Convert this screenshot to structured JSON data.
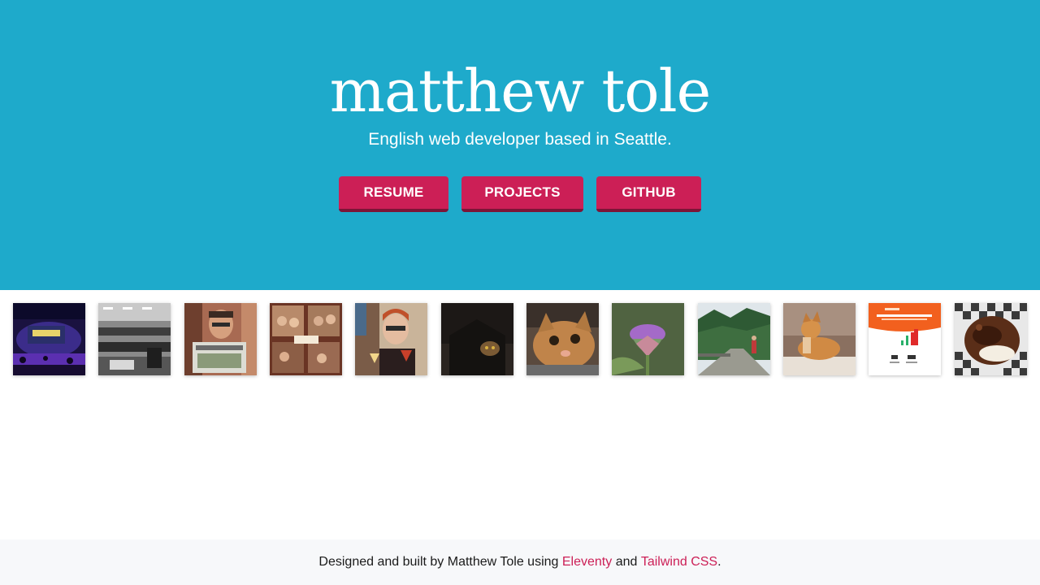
{
  "hero": {
    "title": "matthew tole",
    "subtitle": "English web developer based in Seattle.",
    "buttons": [
      {
        "label": "RESUME"
      },
      {
        "label": "PROJECTS"
      },
      {
        "label": "GITHUB"
      }
    ],
    "background_color": "#1eaacb",
    "button_color": "#cc1f56"
  },
  "gallery": {
    "items": [
      {
        "subject": "concert-stage-photo"
      },
      {
        "subject": "black-and-white-office-photo"
      },
      {
        "subject": "man-holding-book-photo"
      },
      {
        "subject": "photo-booth-strip"
      },
      {
        "subject": "woman-with-drink-photo"
      },
      {
        "subject": "cat-in-dark-photo"
      },
      {
        "subject": "cat-closeup-photo"
      },
      {
        "subject": "artichoke-flower-photo"
      },
      {
        "subject": "forest-trestle-photo"
      },
      {
        "subject": "cat-sitting-photo"
      },
      {
        "subject": "infographic-screenshot"
      },
      {
        "subject": "dessert-photo"
      }
    ]
  },
  "footer": {
    "text_before": "Designed and built by Matthew Tole using ",
    "link1": "Eleventy",
    "text_middle": " and ",
    "link2": "Tailwind CSS",
    "text_after": ".",
    "link_color": "#cc1f56",
    "background_color": "#f7f8fa"
  }
}
